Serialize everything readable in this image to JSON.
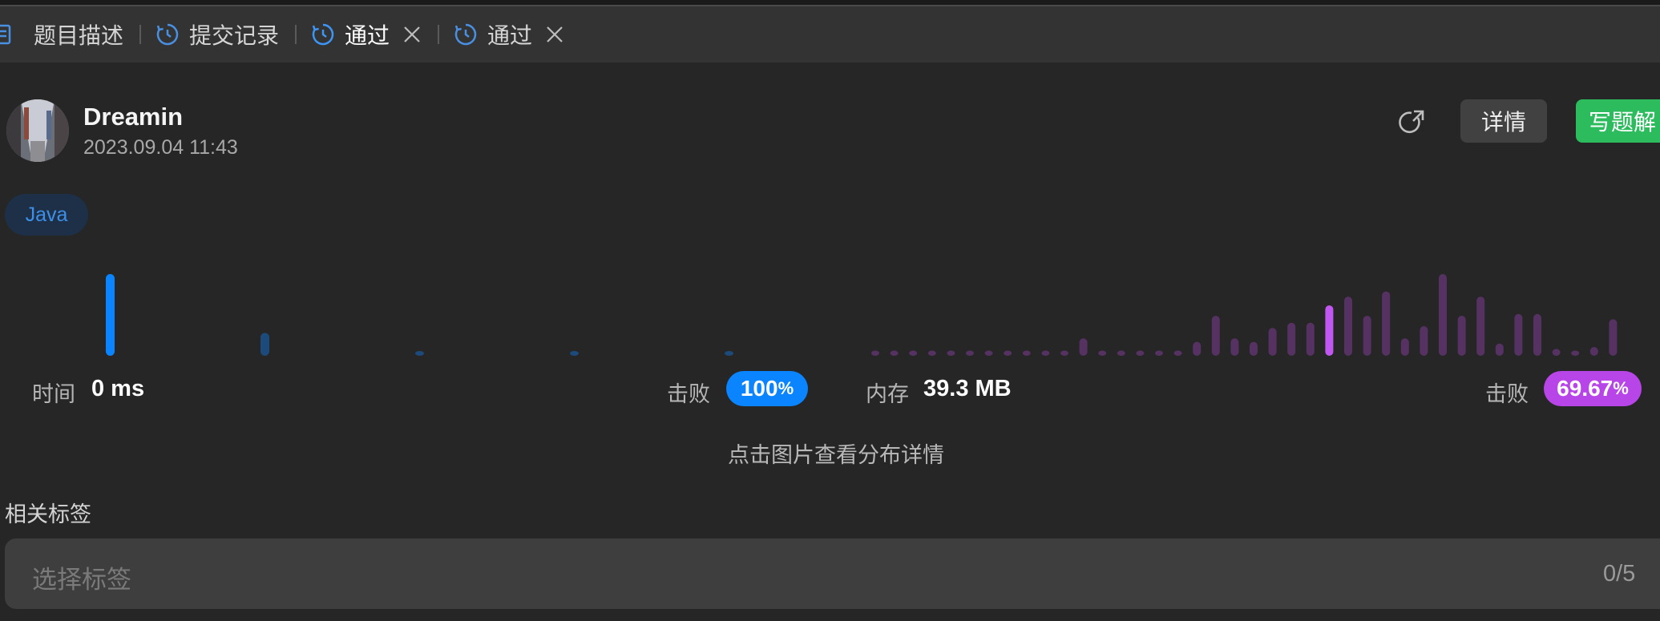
{
  "tabs": [
    {
      "label": "题目描述",
      "icon": "document-icon",
      "active": false,
      "closable": false
    },
    {
      "label": "提交记录",
      "icon": "history-icon",
      "active": false,
      "closable": false
    },
    {
      "label": "通过",
      "icon": "history-icon",
      "active": true,
      "closable": true
    },
    {
      "label": "通过",
      "icon": "history-icon",
      "active": false,
      "closable": true
    }
  ],
  "submission": {
    "username": "Dreamin",
    "datetime": "2023.09.04 11:43",
    "language": "Java"
  },
  "actions": {
    "share_icon": "share-icon",
    "detail_label": "详情",
    "write_solution_label": "写题解"
  },
  "stats": {
    "runtime_label": "时间",
    "runtime_value": "0 ms",
    "runtime_beats_label": "击败",
    "runtime_beats_value": "100",
    "runtime_beats_unit": "%",
    "memory_label": "内存",
    "memory_value": "39.3 MB",
    "memory_beats_label": "击败",
    "memory_beats_value": "69.67",
    "memory_beats_unit": "%"
  },
  "hint": "点击图片查看分布详情",
  "tags": {
    "title": "相关标签",
    "placeholder": "选择标签",
    "count": "0/5"
  },
  "colors": {
    "accent_blue": "#0a84ff",
    "accent_purple": "#b845e8",
    "accent_green": "#2cbb5d",
    "background": "#262626"
  },
  "chart_data": [
    {
      "type": "bar",
      "name": "runtime distribution",
      "values": [
        100,
        28,
        5,
        5,
        5
      ],
      "highlight_index": 0
    },
    {
      "type": "bar",
      "name": "memory distribution",
      "values": [
        6,
        6,
        6,
        6,
        6,
        6,
        6,
        6,
        6,
        6,
        6,
        20,
        6,
        6,
        6,
        6,
        6,
        16,
        46,
        20,
        16,
        32,
        38,
        38,
        58,
        68,
        46,
        74,
        20,
        34,
        94,
        46,
        68,
        14,
        48,
        48,
        8,
        6,
        10,
        42
      ],
      "highlight_index": 24
    }
  ]
}
